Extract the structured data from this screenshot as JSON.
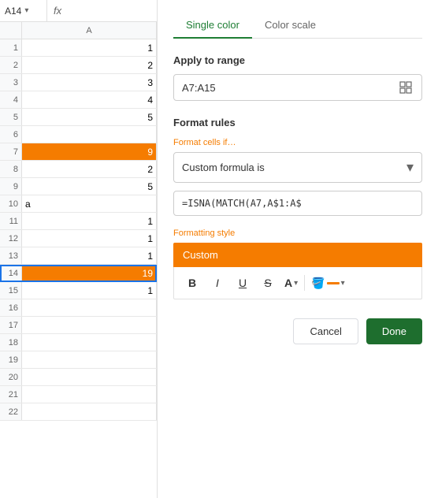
{
  "cell_ref": {
    "label": "A14",
    "dropdown": "▾",
    "fx": "fx"
  },
  "column_header": "A",
  "rows": [
    {
      "num": 1,
      "value": "1",
      "highlighted": false,
      "selected": false,
      "is_text": false
    },
    {
      "num": 2,
      "value": "2",
      "highlighted": false,
      "selected": false,
      "is_text": false
    },
    {
      "num": 3,
      "value": "3",
      "highlighted": false,
      "selected": false,
      "is_text": false
    },
    {
      "num": 4,
      "value": "4",
      "highlighted": false,
      "selected": false,
      "is_text": false
    },
    {
      "num": 5,
      "value": "5",
      "highlighted": false,
      "selected": false,
      "is_text": false
    },
    {
      "num": 6,
      "value": "",
      "highlighted": false,
      "selected": false,
      "is_text": false
    },
    {
      "num": 7,
      "value": "9",
      "highlighted": true,
      "selected": false,
      "is_text": false
    },
    {
      "num": 8,
      "value": "2",
      "highlighted": false,
      "selected": false,
      "is_text": false
    },
    {
      "num": 9,
      "value": "5",
      "highlighted": false,
      "selected": false,
      "is_text": false
    },
    {
      "num": 10,
      "value": "a",
      "highlighted": false,
      "selected": false,
      "is_text": true
    },
    {
      "num": 11,
      "value": "1",
      "highlighted": false,
      "selected": false,
      "is_text": false
    },
    {
      "num": 12,
      "value": "1",
      "highlighted": false,
      "selected": false,
      "is_text": false
    },
    {
      "num": 13,
      "value": "1",
      "highlighted": false,
      "selected": false,
      "is_text": false
    },
    {
      "num": 14,
      "value": "19",
      "highlighted": true,
      "selected": true,
      "is_text": false
    },
    {
      "num": 15,
      "value": "1",
      "highlighted": false,
      "selected": false,
      "is_text": false
    },
    {
      "num": 16,
      "value": "",
      "highlighted": false,
      "selected": false,
      "is_text": false
    },
    {
      "num": 17,
      "value": "",
      "highlighted": false,
      "selected": false,
      "is_text": false
    },
    {
      "num": 18,
      "value": "",
      "highlighted": false,
      "selected": false,
      "is_text": false
    },
    {
      "num": 19,
      "value": "",
      "highlighted": false,
      "selected": false,
      "is_text": false
    },
    {
      "num": 20,
      "value": "",
      "highlighted": false,
      "selected": false,
      "is_text": false
    },
    {
      "num": 21,
      "value": "",
      "highlighted": false,
      "selected": false,
      "is_text": false
    },
    {
      "num": 22,
      "value": "",
      "highlighted": false,
      "selected": false,
      "is_text": false
    }
  ],
  "panel": {
    "tab_single": "Single color",
    "tab_scale": "Color scale",
    "apply_to_range_label": "Apply to range",
    "range_value": "A7:A15",
    "format_rules_label": "Format rules",
    "format_cells_if_label": "Format cells if…",
    "dropdown_value": "Custom formula is",
    "formula_value": "=ISNA(MATCH(A7,A$1:A$",
    "formatting_style_label": "Formatting style",
    "custom_label": "Custom",
    "toolbar": {
      "bold": "B",
      "italic": "I",
      "underline": "U",
      "strikethrough": "S",
      "font_color_letter": "A",
      "font_color": "#000000",
      "fill_color": "#f57c00"
    },
    "cancel_label": "Cancel",
    "done_label": "Done"
  }
}
